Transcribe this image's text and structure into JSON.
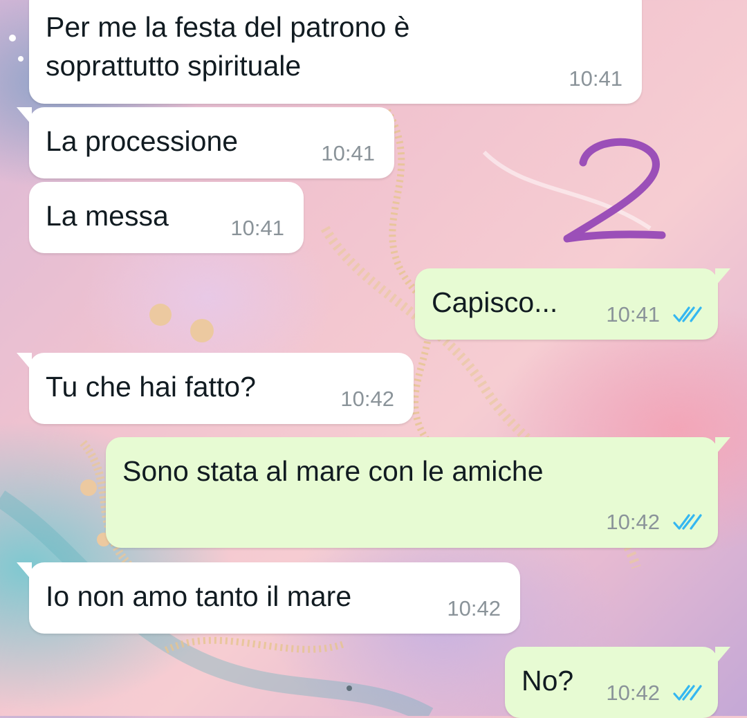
{
  "overlay_number": "2",
  "colors": {
    "incoming_bubble": "#ffffff",
    "outgoing_bubble": "#e7fbd3",
    "read_ticks": "#34b7f1",
    "overlay_number": "#9b4fb8",
    "timestamp": "#8a9399"
  },
  "messages": [
    {
      "direction": "incoming",
      "lines": [
        "Per me la festa del patrono è",
        "soprattutto spirituale"
      ],
      "time": "10:41"
    },
    {
      "direction": "incoming",
      "lines": [
        "La processione"
      ],
      "time": "10:41"
    },
    {
      "direction": "incoming",
      "lines": [
        "La messa"
      ],
      "time": "10:41"
    },
    {
      "direction": "outgoing",
      "lines": [
        "Capisco..."
      ],
      "time": "10:41",
      "status_icon": "double-check-read-icon"
    },
    {
      "direction": "incoming",
      "lines": [
        "Tu che hai fatto?"
      ],
      "time": "10:42"
    },
    {
      "direction": "outgoing",
      "lines": [
        "Sono stata al mare con le amiche"
      ],
      "time": "10:42",
      "status_icon": "double-check-read-icon"
    },
    {
      "direction": "incoming",
      "lines": [
        "Io non amo tanto il mare"
      ],
      "time": "10:42"
    },
    {
      "direction": "outgoing",
      "lines": [
        "No?"
      ],
      "time": "10:42",
      "status_icon": "double-check-read-icon"
    }
  ]
}
